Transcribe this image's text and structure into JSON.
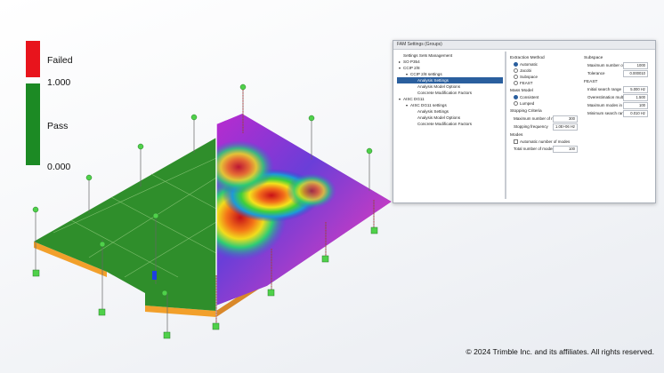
{
  "legend": {
    "failed_label": "Failed",
    "top_value": "1.000",
    "pass_label": "Pass",
    "bottom_value": "0.000",
    "failed_color": "#e8141c",
    "pass_color": "#1c8a24"
  },
  "dialog": {
    "title": "FAM Settings (Groups)",
    "tree": [
      {
        "label": "Settings Sets Management",
        "level": 0,
        "caret": "",
        "selected": false
      },
      {
        "label": "SO P354",
        "level": 0,
        "caret": "▸",
        "selected": false
      },
      {
        "label": "CCIP 2/8",
        "level": 0,
        "caret": "▾",
        "selected": false
      },
      {
        "label": "CCIP 2/8 settings",
        "level": 1,
        "caret": "▾",
        "selected": false
      },
      {
        "label": "Analysis Settings",
        "level": 2,
        "caret": "",
        "selected": true
      },
      {
        "label": "Analysis Model Options",
        "level": 2,
        "caret": "",
        "selected": false
      },
      {
        "label": "Concrete Modification Factors",
        "level": 2,
        "caret": "",
        "selected": false
      },
      {
        "label": "AISC DG11",
        "level": 0,
        "caret": "▾",
        "selected": false
      },
      {
        "label": "AISC DG11 settings",
        "level": 1,
        "caret": "▾",
        "selected": false
      },
      {
        "label": "Analysis Settings",
        "level": 2,
        "caret": "",
        "selected": false
      },
      {
        "label": "Analysis Model Options",
        "level": 2,
        "caret": "",
        "selected": false
      },
      {
        "label": "Concrete Modification Factors",
        "level": 2,
        "caret": "",
        "selected": false
      }
    ],
    "extraction": {
      "title": "Extraction Method",
      "options": [
        {
          "label": "Automatic",
          "on": true
        },
        {
          "label": "Jacobi",
          "on": false
        },
        {
          "label": "Subspace",
          "on": false
        },
        {
          "label": "FEAST",
          "on": false
        }
      ]
    },
    "mass": {
      "title": "Mass Model",
      "options": [
        {
          "label": "Consistent",
          "on": true
        },
        {
          "label": "Lumped",
          "on": false
        }
      ]
    },
    "stopping": {
      "title": "Stopping Criteria",
      "max_modes_label": "Maximum number of modes",
      "max_modes_value": "300",
      "freq_label": "Stopping frequency",
      "freq_value": "1.0E+06 Hz"
    },
    "modes": {
      "title": "Modes",
      "auto_label": "Automatic number of modes",
      "total_label": "Total number of modes",
      "total_value": "100"
    },
    "subspace": {
      "title": "Subspace",
      "iter_label": "Maximum number of iterations",
      "iter_value": "1000",
      "tol_label": "Tolerance",
      "tol_value": "0.000010"
    },
    "feast": {
      "title": "FEAST",
      "init_label": "Initial search range",
      "init_value": "5.000 Hz",
      "over_label": "Overestimation multiplier, m",
      "over_value": "1.500",
      "maxrange_label": "Maximum modes in range",
      "maxrange_value": "100",
      "minrange_label": "Minimum search range",
      "minrange_value": "0.010 Hz"
    }
  },
  "copyright": "© 2024 Trimble Inc. and its affiliates. All rights reserved."
}
